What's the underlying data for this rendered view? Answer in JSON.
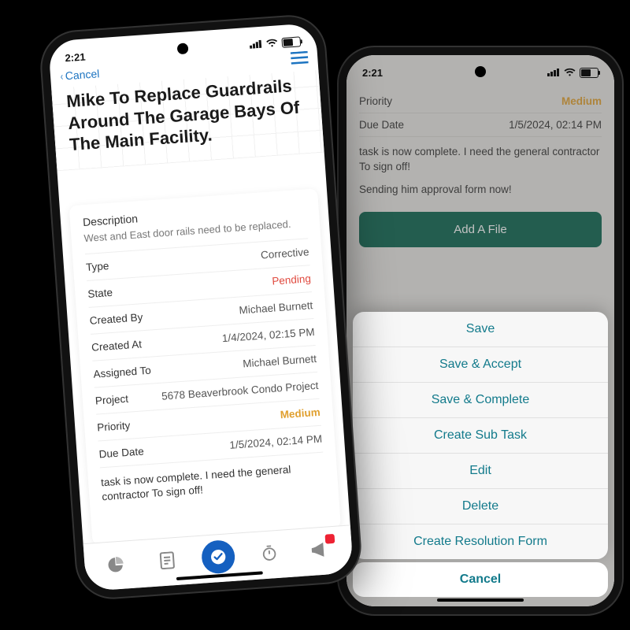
{
  "status_time": "2:21",
  "phoneA": {
    "nav_back_label": "Cancel",
    "title": "Mike To Replace Guardrails Around The Garage Bays Of The Main Facility.",
    "description_label": "Description",
    "description_text": "West and East door rails need to be replaced.",
    "rows": [
      {
        "k": "Type",
        "v": "Corrective",
        "cls": ""
      },
      {
        "k": "State",
        "v": "Pending",
        "cls": "red"
      },
      {
        "k": "Created By",
        "v": "Michael Burnett",
        "cls": ""
      },
      {
        "k": "Created At",
        "v": "1/4/2024, 02:15 PM",
        "cls": ""
      },
      {
        "k": "Assigned To",
        "v": "Michael Burnett",
        "cls": ""
      },
      {
        "k": "Project",
        "v": "5678 Beaverbrook Condo Project",
        "cls": ""
      },
      {
        "k": "Priority",
        "v": "Medium",
        "cls": "amber"
      },
      {
        "k": "Due Date",
        "v": "1/5/2024, 02:14 PM",
        "cls": ""
      }
    ],
    "note": "task is now complete. I need the general contractor To sign off!"
  },
  "phoneB": {
    "priority_label": "Priority",
    "priority_value": "Medium",
    "due_label": "Due Date",
    "due_value": "1/5/2024, 02:14 PM",
    "note1": "task is now complete. I need the general contractor To sign off!",
    "note2": "Sending him approval form now!",
    "add_file_label": "Add A File",
    "actions": [
      "Save",
      "Save & Accept",
      "Save & Complete",
      "Create Sub Task",
      "Edit",
      "Delete",
      "Create Resolution Form"
    ],
    "cancel_label": "Cancel"
  }
}
